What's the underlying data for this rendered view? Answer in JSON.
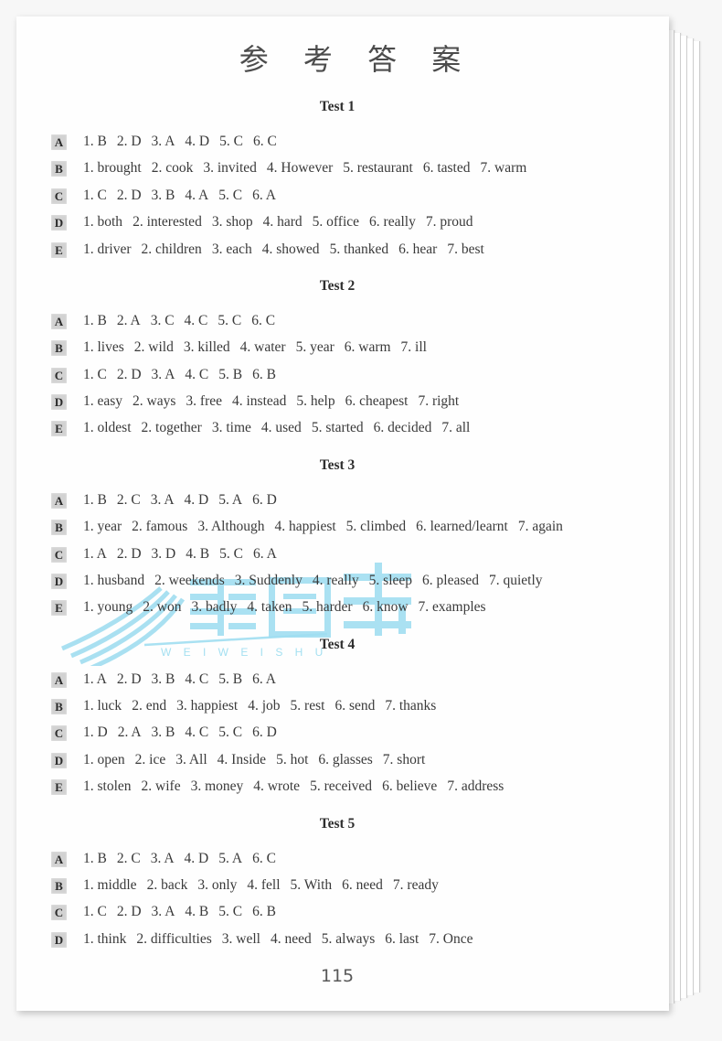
{
  "document": {
    "title": "参 考 答 案",
    "page_number": "115",
    "watermark": {
      "text_cn": "蔚蔚图书",
      "text_en": "W E I W E I   S H U",
      "color": "#8fd8ee"
    }
  },
  "tests": [
    {
      "heading": "Test 1",
      "rows": [
        {
          "section": "A",
          "items": [
            "1. B",
            "2. D",
            "3. A",
            "4. D",
            "5. C",
            "6. C"
          ]
        },
        {
          "section": "B",
          "items": [
            "1. brought",
            "2. cook",
            "3. invited",
            "4. However",
            "5. restaurant",
            "6. tasted",
            "7. warm"
          ]
        },
        {
          "section": "C",
          "items": [
            "1. C",
            "2. D",
            "3. B",
            "4. A",
            "5. C",
            "6. A"
          ]
        },
        {
          "section": "D",
          "items": [
            "1. both",
            "2. interested",
            "3. shop",
            "4. hard",
            "5. office",
            "6. really",
            "7. proud"
          ]
        },
        {
          "section": "E",
          "items": [
            "1. driver",
            "2. children",
            "3. each",
            "4. showed",
            "5. thanked",
            "6. hear",
            "7. best"
          ]
        }
      ]
    },
    {
      "heading": "Test 2",
      "rows": [
        {
          "section": "A",
          "items": [
            "1. B",
            "2. A",
            "3. C",
            "4. C",
            "5. C",
            "6. C"
          ]
        },
        {
          "section": "B",
          "items": [
            "1. lives",
            "2. wild",
            "3. killed",
            "4. water",
            "5. year",
            "6. warm",
            "7. ill"
          ]
        },
        {
          "section": "C",
          "items": [
            "1. C",
            "2. D",
            "3. A",
            "4. C",
            "5. B",
            "6. B"
          ]
        },
        {
          "section": "D",
          "items": [
            "1. easy",
            "2. ways",
            "3. free",
            "4. instead",
            "5. help",
            "6. cheapest",
            "7. right"
          ]
        },
        {
          "section": "E",
          "items": [
            "1. oldest",
            "2. together",
            "3. time",
            "4. used",
            "5. started",
            "6. decided",
            "7. all"
          ]
        }
      ]
    },
    {
      "heading": "Test 3",
      "rows": [
        {
          "section": "A",
          "items": [
            "1. B",
            "2. C",
            "3. A",
            "4. D",
            "5. A",
            "6. D"
          ]
        },
        {
          "section": "B",
          "items": [
            "1. year",
            "2. famous",
            "3. Although",
            "4. happiest",
            "5. climbed",
            "6. learned/learnt",
            "7. again"
          ]
        },
        {
          "section": "C",
          "items": [
            "1. A",
            "2. D",
            "3. D",
            "4. B",
            "5. C",
            "6. A"
          ]
        },
        {
          "section": "D",
          "items": [
            "1. husband",
            "2. weekends",
            "3. Suddenly",
            "4. really",
            "5. sleep",
            "6. pleased",
            "7. quietly"
          ]
        },
        {
          "section": "E",
          "items": [
            "1. young",
            "2. won",
            "3. badly",
            "4. taken",
            "5. harder",
            "6. know",
            "7. examples"
          ]
        }
      ]
    },
    {
      "heading": "Test 4",
      "rows": [
        {
          "section": "A",
          "items": [
            "1. A",
            "2. D",
            "3. B",
            "4. C",
            "5. B",
            "6. A"
          ]
        },
        {
          "section": "B",
          "items": [
            "1. luck",
            "2. end",
            "3. happiest",
            "4. job",
            "5. rest",
            "6. send",
            "7. thanks"
          ]
        },
        {
          "section": "C",
          "items": [
            "1. D",
            "2. A",
            "3. B",
            "4. C",
            "5. C",
            "6. D"
          ]
        },
        {
          "section": "D",
          "items": [
            "1. open",
            "2. ice",
            "3. All",
            "4. Inside",
            "5. hot",
            "6. glasses",
            "7. short"
          ]
        },
        {
          "section": "E",
          "items": [
            "1. stolen",
            "2. wife",
            "3. money",
            "4. wrote",
            "5. received",
            "6. believe",
            "7. address"
          ]
        }
      ]
    },
    {
      "heading": "Test 5",
      "rows": [
        {
          "section": "A",
          "items": [
            "1. B",
            "2. C",
            "3. A",
            "4. D",
            "5. A",
            "6. C"
          ]
        },
        {
          "section": "B",
          "items": [
            "1. middle",
            "2. back",
            "3. only",
            "4. fell",
            "5. With",
            "6. need",
            "7. ready"
          ]
        },
        {
          "section": "C",
          "items": [
            "1. C",
            "2. D",
            "3. A",
            "4. B",
            "5. C",
            "6. B"
          ]
        },
        {
          "section": "D",
          "items": [
            "1. think",
            "2. difficulties",
            "3. well",
            "4. need",
            "5. always",
            "6. last",
            "7. Once"
          ]
        }
      ]
    }
  ]
}
